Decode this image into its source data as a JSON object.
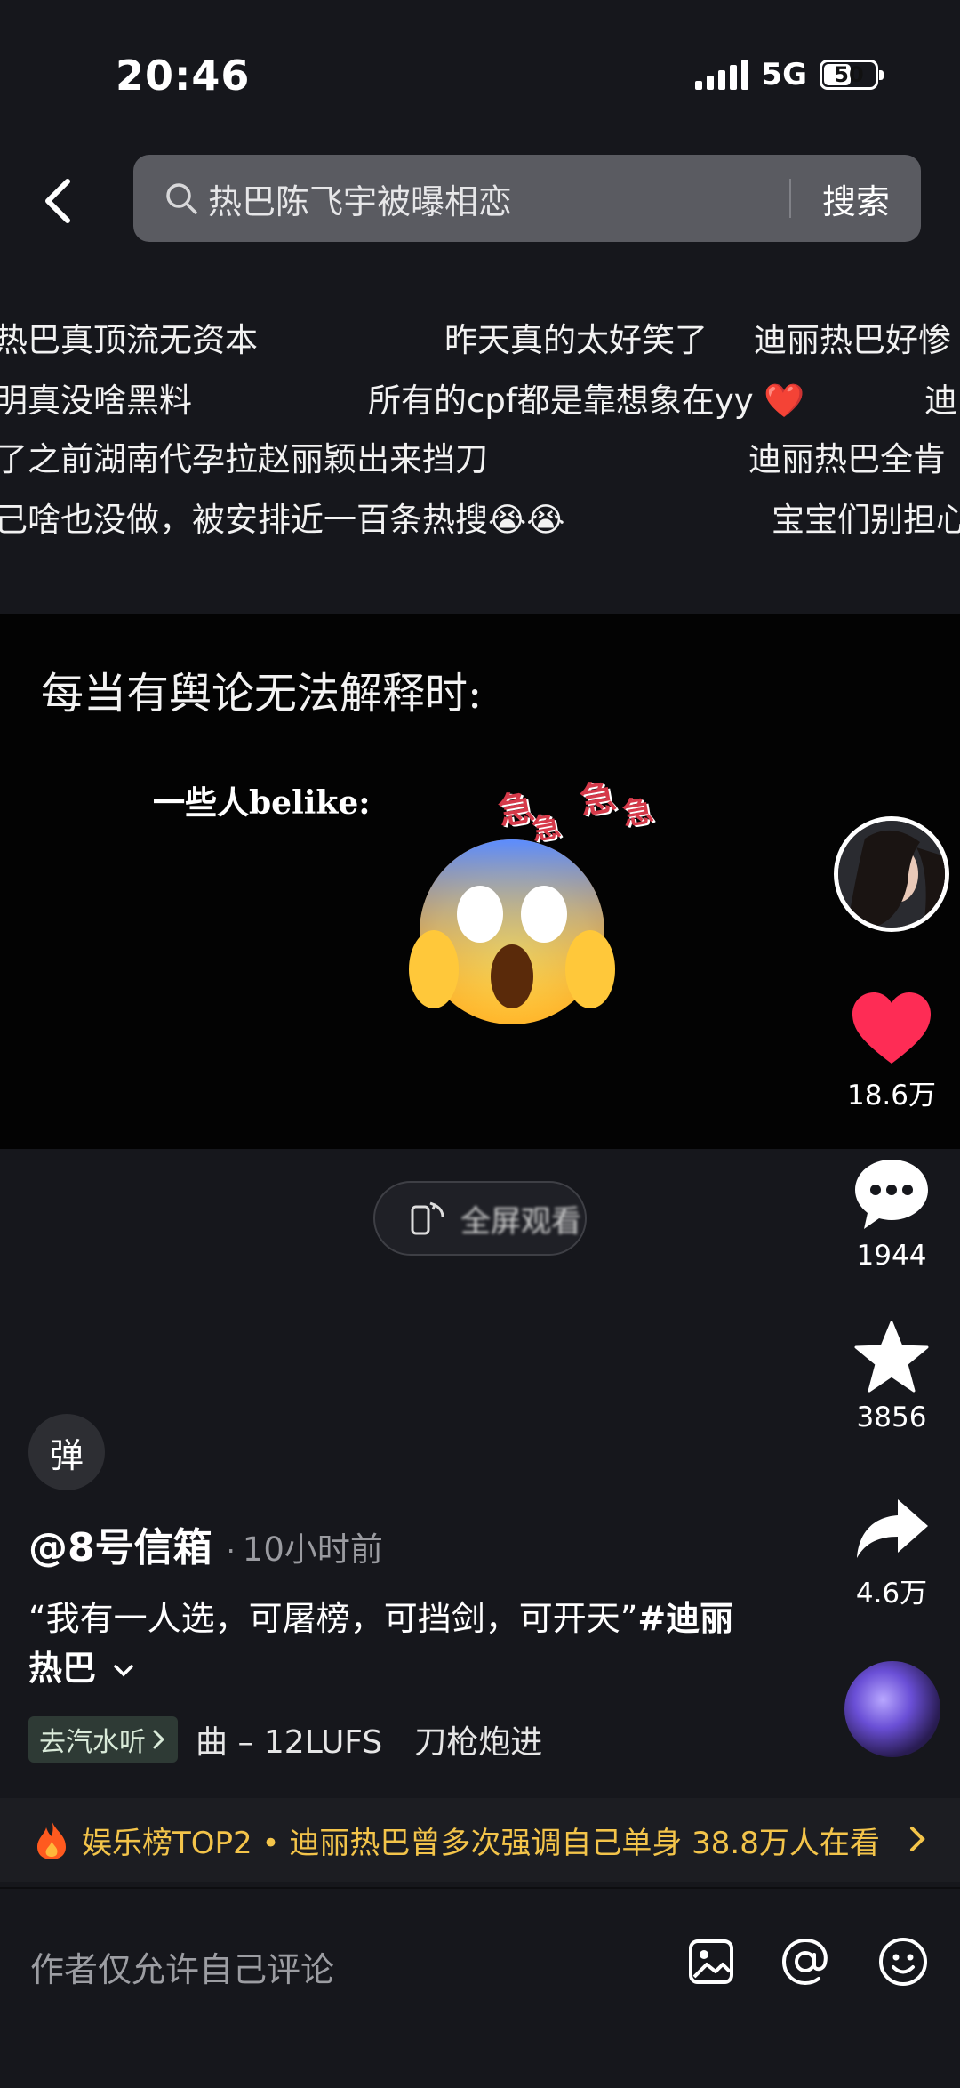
{
  "status_bar": {
    "time": "20:46",
    "network": "5G",
    "battery": "50",
    "battery_level": 0.5
  },
  "search": {
    "query": "热巴陈飞宇被曝相恋",
    "button": "搜索"
  },
  "barrage": [
    "热巴真顶流无资本",
    "昨天真的太好笑了",
    "迪丽热巴好惨",
    "明真没啥黑料",
    "所有的cpf都是靠想象在yy ❤️",
    "迪",
    "了之前湖南代孕拉赵丽颖出来挡刀",
    "迪丽热巴全肯",
    "己啥也没做，被安排近一百条热搜😭😭",
    "宝宝们别担心"
  ],
  "video": {
    "caption": "每当有舆论无法解释时:",
    "subcaption": "一些人belike:",
    "sticker_chars": [
      "急",
      "急",
      "急",
      "急"
    ],
    "emoji": "😱",
    "rotate_label": "全屏观看"
  },
  "rail": {
    "like_count": "18.6万",
    "comment_count": "1944",
    "favorite_count": "3856",
    "share_count": "4.6万"
  },
  "post": {
    "danmu_toggle": "弹",
    "author": "@8号信箱",
    "time": "10小时前",
    "description": "“我有一人选，可屠榜，可挡剑，可开天”",
    "hashtag": "#迪丽热巴",
    "music_chip": "去汽水听",
    "music": "曲 – 12LUFS　刀枪炮进"
  },
  "trending": {
    "text": "娱乐榜TOP2 • 迪丽热巴曾多次强调自己单身 38.8万人在看"
  },
  "comment": {
    "placeholder": "作者仅允许自己评论"
  },
  "colors": {
    "like": "#fe2c55",
    "trend": "#f3c44a",
    "search_bg": "#5a5b61"
  }
}
